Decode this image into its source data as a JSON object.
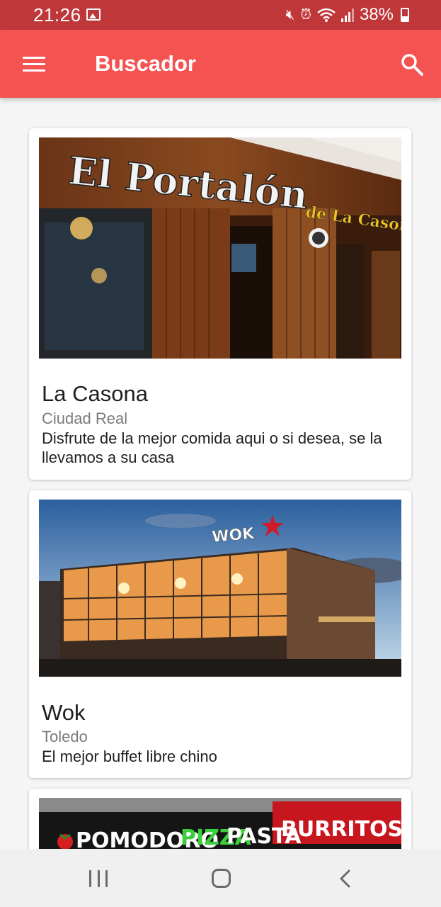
{
  "status_bar": {
    "time": "21:26",
    "battery_text": "38%",
    "icons": [
      "image-icon",
      "mute-icon",
      "alarm-icon",
      "wifi-icon",
      "signal-icon",
      "battery-icon"
    ]
  },
  "app_bar": {
    "title": "Buscador",
    "menu_icon": "menu-icon",
    "search_icon": "search-icon"
  },
  "restaurants": [
    {
      "name": "La Casona",
      "city": "Ciudad Real",
      "description": "Disfrute de la mejor comida aqui o si desea, se la llevamos a su casa",
      "sign_text_1": "El Portalón",
      "sign_text_2": "de La Casona"
    },
    {
      "name": "Wok",
      "city": "Toledo",
      "description": "El mejor buffet libre chino",
      "sign_text": "WOK"
    },
    {
      "sign_words": [
        "POMODORO",
        "PIZZA",
        "PASTA",
        "BURRITOS"
      ]
    }
  ],
  "colors": {
    "app_bar": "#f55252",
    "status_bar": "#c0373a",
    "background": "#f5f5f5"
  }
}
